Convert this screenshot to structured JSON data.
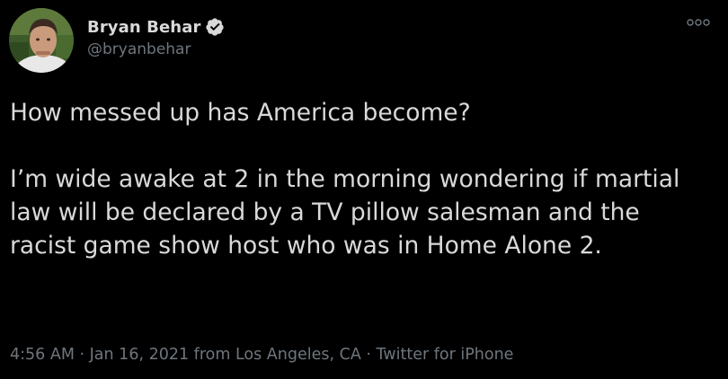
{
  "author": {
    "display_name": "Bryan Behar",
    "handle": "@bryanbehar",
    "verified": true,
    "verified_icon": "verified-badge-icon"
  },
  "more_icon": "more-options-icon",
  "tweet": {
    "text": "How messed up has America become?\n\nI’m wide awake at 2 in the morning wondering if martial law will be declared by a TV pillow salesman and the racist game show host who was in Home Alone 2."
  },
  "meta": {
    "time": "4:56 AM",
    "separator": " · ",
    "date": "Jan 16, 2021",
    "from_prefix": " from ",
    "location": "Los Angeles, CA",
    "source": "Twitter for iPhone"
  },
  "colors": {
    "background": "#000000",
    "text": "#d9d9d9",
    "secondary": "#6e767d",
    "verified": "#d9d9d9"
  }
}
